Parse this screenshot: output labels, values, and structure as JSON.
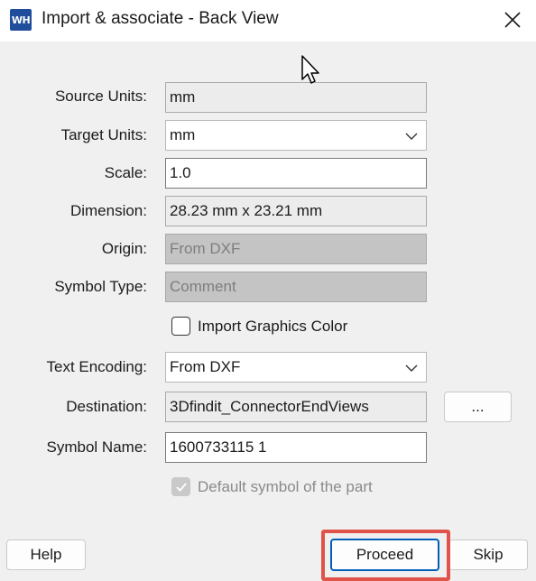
{
  "window": {
    "app_icon": "WH",
    "title": "Import & associate - Back View"
  },
  "form": {
    "source_units_label": "Source Units:",
    "source_units_value": "mm",
    "target_units_label": "Target Units:",
    "target_units_value": "mm",
    "scale_label": "Scale:",
    "scale_value": "1.0",
    "dimension_label": "Dimension:",
    "dimension_value": "28.23 mm x 23.21 mm",
    "origin_label": "Origin:",
    "origin_value": "From DXF",
    "symbol_type_label": "Symbol Type:",
    "symbol_type_value": "Comment",
    "import_graphics_color_label": "Import Graphics Color",
    "text_encoding_label": "Text Encoding:",
    "text_encoding_value": "From DXF",
    "destination_label": "Destination:",
    "destination_value": "3Dfindit_ConnectorEndViews",
    "browse_label": "...",
    "symbol_name_label": "Symbol Name:",
    "symbol_name_value": "1600733115 1",
    "default_symbol_label": "Default symbol of the part"
  },
  "buttons": {
    "help": "Help",
    "proceed": "Proceed",
    "skip": "Skip"
  },
  "colors": {
    "highlight": "#e0534a",
    "accent": "#005fb8",
    "icon_bg": "#1f4e9c"
  }
}
